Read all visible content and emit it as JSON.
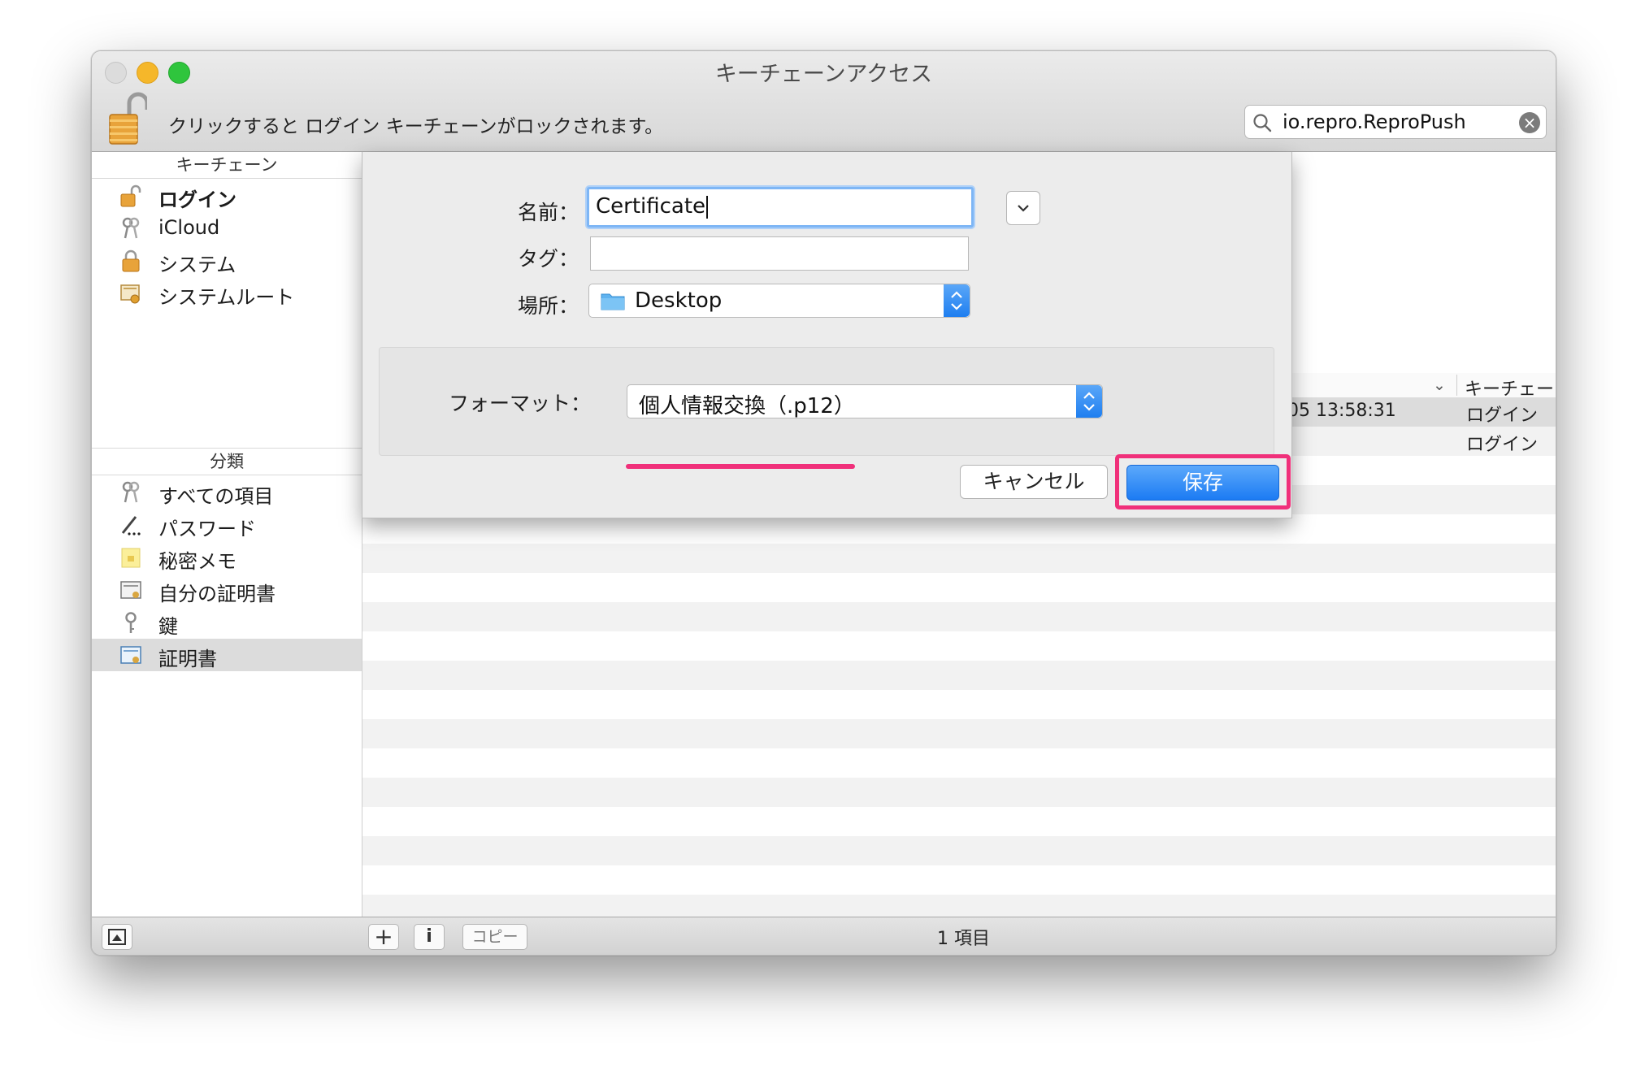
{
  "window": {
    "title": "キーチェーンアクセス"
  },
  "toolbar": {
    "lock_text": "クリックすると ログイン キーチェーンがロックされます。",
    "search_value": "io.repro.ReproPush"
  },
  "sidebar": {
    "keychains_header": "キーチェーン",
    "keychains": [
      {
        "label": "ログイン"
      },
      {
        "label": "iCloud"
      },
      {
        "label": "システム"
      },
      {
        "label": "システムルート"
      }
    ],
    "category_header": "分類",
    "categories": [
      {
        "label": "すべての項目"
      },
      {
        "label": "パスワード"
      },
      {
        "label": "秘密メモ"
      },
      {
        "label": "自分の証明書"
      },
      {
        "label": "鍵"
      },
      {
        "label": "証明書"
      }
    ]
  },
  "list": {
    "column_keychain": "キーチェーン",
    "rows": [
      {
        "date": "05 13:58:31",
        "keychain": "ログイン"
      },
      {
        "date": "",
        "keychain": "ログイン"
      }
    ]
  },
  "dialog": {
    "name_label": "名前：",
    "name_value": "Certificate",
    "tags_label": "タグ：",
    "tags_value": "",
    "location_label": "場所：",
    "location_value": "Desktop",
    "format_label": "フォーマット：",
    "format_value": "個人情報交換（.p12）",
    "cancel_label": "キャンセル",
    "save_label": "保存"
  },
  "statusbar": {
    "copy_label": "コピー",
    "info_label": "i",
    "status": "1 項目"
  },
  "colors": {
    "accent": "#1c7bf3",
    "highlight": "#f0307a"
  }
}
